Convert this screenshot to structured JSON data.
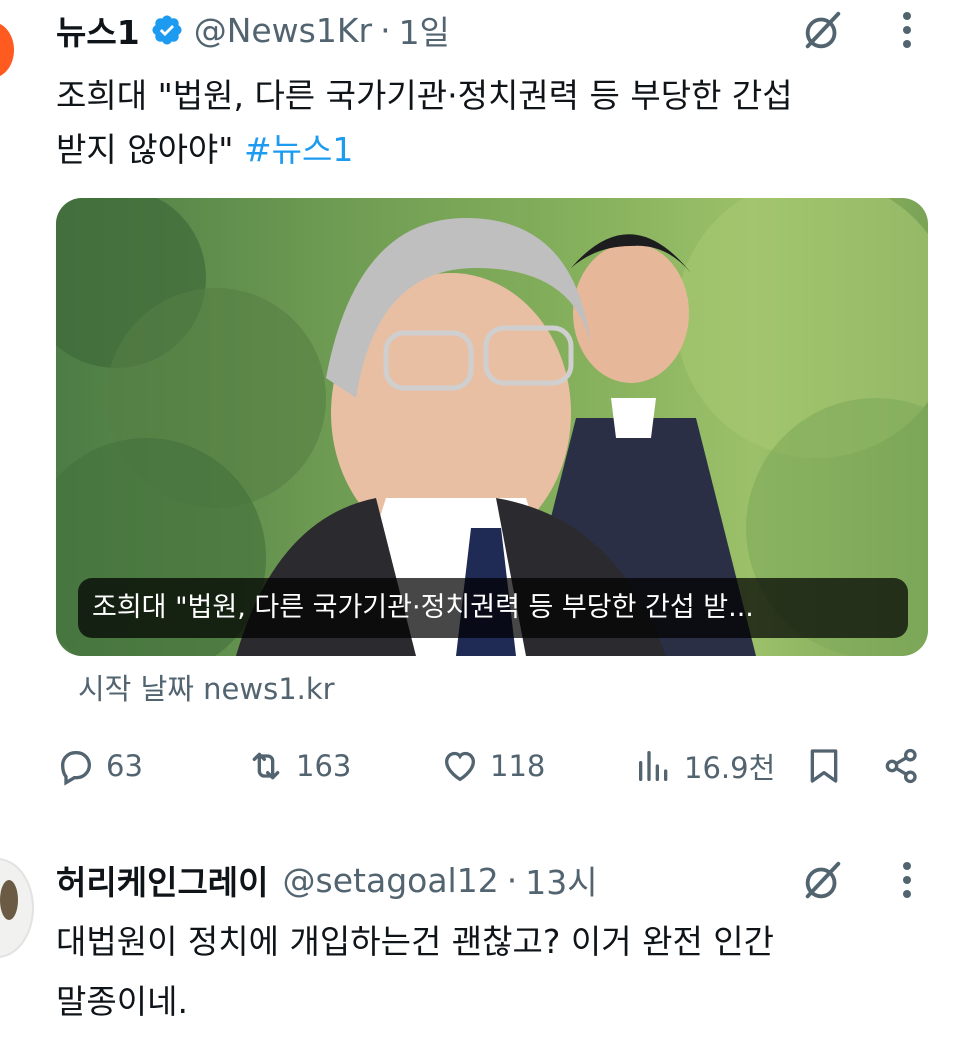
{
  "tweet": {
    "author_name": "뉴스1",
    "handle": "@News1Kr",
    "separator": "·",
    "time": "1일",
    "text_line1": "조희대 \"법원, 다른 국가기관·정치권력 등 부당한 간섭",
    "text_line2": "받지 않아야\"",
    "hashtag": "#뉴스1",
    "card_caption": "조희대 \"법원, 다른 국가기관·정치권력 등 부당한 간섭 받...",
    "source": "시작 날짜 news1.kr",
    "stats": {
      "replies": "63",
      "retweets": "163",
      "likes": "118",
      "views": "16.9천"
    }
  },
  "reply": {
    "author_name": "허리케인그레이",
    "handle": "@setagoal12",
    "separator": "·",
    "time": "13시",
    "text_line1": "대법원이 정치에 개입하는건 괜찮고? 이거 완전 인간",
    "text_line2": "말종이네."
  },
  "colors": {
    "text": "#0f1419",
    "secondary": "#536471",
    "accent": "#1d9bf0"
  }
}
